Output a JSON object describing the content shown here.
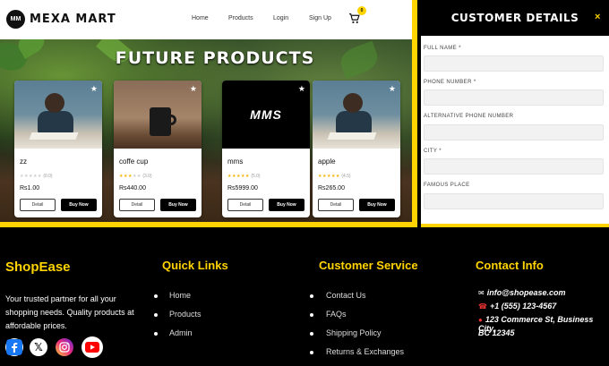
{
  "navbar": {
    "logo_text": "MM",
    "brand": "MEXA MART",
    "links": [
      "Home",
      "Products",
      "Login",
      "Sign Up"
    ],
    "cart_count": "0"
  },
  "hero": {
    "title": "FUTURE PRODUCTS"
  },
  "products": [
    {
      "name": "zz",
      "rating": "(0.0)",
      "price": "Rs1.00",
      "detail_label": "Detail",
      "buy_label": "Buy Now",
      "image": "man-at-desk"
    },
    {
      "name": "coffe cup",
      "rating": "(3.0)",
      "price": "Rs440.00",
      "detail_label": "Detail",
      "buy_label": "Buy Now",
      "image": "coffee-mug"
    },
    {
      "name": "mms",
      "rating": "(5.0)",
      "price": "Rs5999.00",
      "detail_label": "Detail",
      "buy_label": "Buy Now",
      "image": "mms-logo",
      "image_text": "MMS"
    },
    {
      "name": "apple",
      "rating": "(4.5)",
      "price": "Rs265.00",
      "detail_label": "Detail",
      "buy_label": "Buy Now",
      "image": "man-at-desk"
    }
  ],
  "panel": {
    "title": "CUSTOMER DETAILS",
    "close": "×",
    "fields": [
      {
        "label": "FULL NAME *",
        "value": ""
      },
      {
        "label": "PHONE NUMBER *",
        "value": ""
      },
      {
        "label": "ALTERNATIVE PHONE NUMBER",
        "value": ""
      },
      {
        "label": "CITY *",
        "value": ""
      },
      {
        "label": "FAMOUS PLACE",
        "value": ""
      }
    ]
  },
  "footer": {
    "brand": "ShopEase",
    "tagline": "Your trusted partner for all your shopping needs. Quality products at affordable prices.",
    "quick_links": {
      "heading": "Quick Links",
      "items": [
        "Home",
        "Products",
        "Admin"
      ]
    },
    "customer_service": {
      "heading": "Customer Service",
      "items": [
        "Contact Us",
        "FAQs",
        "Shipping Policy",
        "Returns & Exchanges"
      ]
    },
    "contact": {
      "heading": "Contact Info",
      "email": "info@shopease.com",
      "phone": "+1 (555) 123-4567",
      "address_line1": "123 Commerce St, Business City,",
      "address_line2": "BC 12345"
    },
    "social": [
      "facebook-icon",
      "x-icon",
      "instagram-icon",
      "youtube-icon"
    ]
  },
  "colors": {
    "accent": "#ffd400",
    "dark": "#000000"
  }
}
